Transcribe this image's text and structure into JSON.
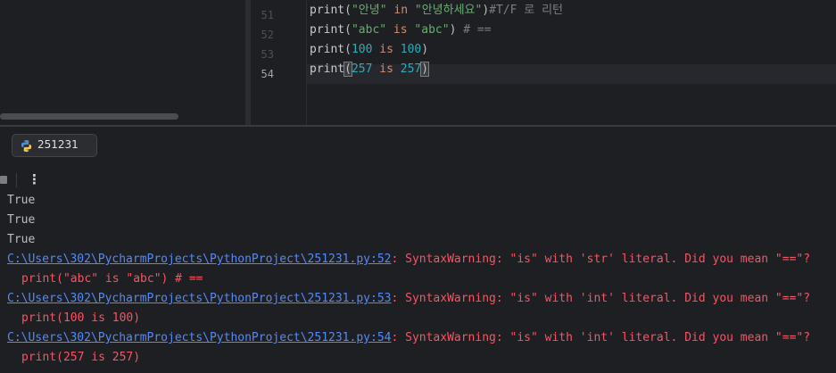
{
  "editor": {
    "lines": [
      {
        "number": "51",
        "tokens": [
          {
            "t": "print",
            "c": "fn"
          },
          {
            "t": "(",
            "c": "paren"
          },
          {
            "t": "\"안녕\"",
            "c": "str"
          },
          {
            "t": " in ",
            "c": "kw"
          },
          {
            "t": "\"안녕하세요\"",
            "c": "str"
          },
          {
            "t": ")",
            "c": "paren"
          },
          {
            "t": "#T/F 로 리턴",
            "c": "comment"
          }
        ]
      },
      {
        "number": "52",
        "tokens": [
          {
            "t": "print",
            "c": "fn"
          },
          {
            "t": "(",
            "c": "paren"
          },
          {
            "t": "\"abc\"",
            "c": "str"
          },
          {
            "t": " is ",
            "c": "kw"
          },
          {
            "t": "\"abc\"",
            "c": "str"
          },
          {
            "t": ")",
            "c": "paren"
          },
          {
            "t": " # ==",
            "c": "comment"
          }
        ]
      },
      {
        "number": "53",
        "tokens": [
          {
            "t": "print",
            "c": "fn"
          },
          {
            "t": "(",
            "c": "paren"
          },
          {
            "t": "100",
            "c": "num"
          },
          {
            "t": " is ",
            "c": "kw"
          },
          {
            "t": "100",
            "c": "num"
          },
          {
            "t": ")",
            "c": "paren"
          }
        ]
      },
      {
        "number": "54",
        "current": true,
        "tokens": [
          {
            "t": "print",
            "c": "fn"
          },
          {
            "t": "(",
            "c": "paren-match"
          },
          {
            "t": "257",
            "c": "num"
          },
          {
            "t": " is ",
            "c": "kw"
          },
          {
            "t": "257",
            "c": "num"
          },
          {
            "t": ")",
            "c": "paren-match"
          },
          {
            "t": "",
            "c": "caret"
          }
        ]
      }
    ]
  },
  "run_panel": {
    "tab_label": "251231",
    "tab_icon": "python-icon",
    "toolbar": {
      "stop_icon": "stop-icon",
      "more_icon": "more-options-icon",
      "more_glyph": "⋮"
    }
  },
  "console": {
    "lines": [
      {
        "segments": [
          {
            "t": "True",
            "c": "out"
          }
        ]
      },
      {
        "segments": [
          {
            "t": "True",
            "c": "out"
          }
        ]
      },
      {
        "segments": [
          {
            "t": "True",
            "c": "out"
          }
        ]
      },
      {
        "segments": [
          {
            "t": "C:\\Users\\302\\PycharmProjects\\PythonProject\\251231.py:52",
            "c": "link"
          },
          {
            "t": ": SyntaxWarning: \"is\" with 'str' literal. Did you mean \"==\"?",
            "c": "err"
          }
        ]
      },
      {
        "indent": true,
        "segments": [
          {
            "t": "print(\"abc\" is \"abc\") # ==",
            "c": "err"
          }
        ]
      },
      {
        "segments": [
          {
            "t": "C:\\Users\\302\\PycharmProjects\\PythonProject\\251231.py:53",
            "c": "link"
          },
          {
            "t": ": SyntaxWarning: \"is\" with 'int' literal. Did you mean \"==\"?",
            "c": "err"
          }
        ]
      },
      {
        "indent": true,
        "segments": [
          {
            "t": "print(100 is 100)",
            "c": "err"
          }
        ]
      },
      {
        "segments": [
          {
            "t": "C:\\Users\\302\\PycharmProjects\\PythonProject\\251231.py:54",
            "c": "link"
          },
          {
            "t": ": SyntaxWarning: \"is\" with 'int' literal. Did you mean \"==\"?",
            "c": "err"
          }
        ]
      },
      {
        "indent": true,
        "segments": [
          {
            "t": "print(257 is 257)",
            "c": "err"
          }
        ]
      }
    ]
  },
  "colors": {
    "background": "#1e1f22",
    "link": "#548af7",
    "error": "#f75464",
    "string": "#6aab73",
    "keyword": "#cf8e6d",
    "number": "#2aacb8",
    "comment": "#7a7e85"
  }
}
